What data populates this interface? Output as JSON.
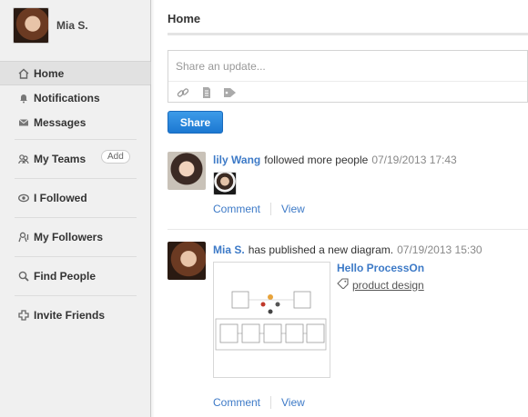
{
  "profile": {
    "name": "Mia S."
  },
  "nav": {
    "items": [
      {
        "label": "Home",
        "icon": "home-icon"
      },
      {
        "label": "Notifications",
        "icon": "bell-icon"
      },
      {
        "label": "Messages",
        "icon": "envelope-icon"
      },
      {
        "label": "My Teams",
        "icon": "team-icon",
        "badge": "Add"
      },
      {
        "label": "I Followed",
        "icon": "eye-icon"
      },
      {
        "label": "My Followers",
        "icon": "followers-icon"
      },
      {
        "label": "Find People",
        "icon": "search-people-icon"
      },
      {
        "label": "Invite Friends",
        "icon": "plus-icon"
      }
    ]
  },
  "main": {
    "title": "Home",
    "composer": {
      "placeholder": "Share an update...",
      "share_label": "Share"
    }
  },
  "feed": [
    {
      "user": "lily Wang",
      "action": "followed more people",
      "timestamp": "07/19/2013 17:43",
      "comment": "Comment",
      "view": "View"
    },
    {
      "user": "Mia S.",
      "action": "has published a new diagram.",
      "timestamp": "07/19/2013 15:30",
      "diagram_title": "Hello ProcessOn",
      "tag": "product design",
      "comment": "Comment",
      "view": "View"
    }
  ],
  "colors": {
    "accent": "#3d7ac7",
    "button": "#2283da",
    "sidebar_bg": "#f0f0f0"
  }
}
